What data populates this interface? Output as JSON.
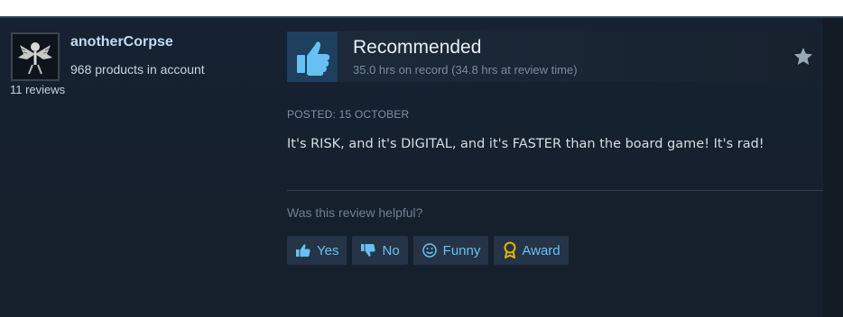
{
  "reviewer": {
    "username": "anotherCorpse",
    "products_text": "968 products in account",
    "reviews_text": "11 reviews",
    "avatar_icon": "skeletal-bird-avatar"
  },
  "review": {
    "verdict": "Recommended",
    "hours_text": "35.0 hrs on record (34.8 hrs at review time)",
    "posted_text": "POSTED: 15 OCTOBER",
    "body": "It's RISK, and it's DIGITAL, and it's FASTER than the board game! It's rad!",
    "thumb_icon": "thumbs-up-icon",
    "star_icon": "star-icon"
  },
  "helpful": {
    "question": "Was this review helpful?",
    "buttons": [
      {
        "label": "Yes",
        "icon": "thumbs-up-icon"
      },
      {
        "label": "No",
        "icon": "thumbs-down-icon"
      },
      {
        "label": "Funny",
        "icon": "smiley-icon"
      },
      {
        "label": "Award",
        "icon": "award-icon"
      }
    ]
  },
  "colors": {
    "card_bg": "#16202d",
    "accent_link": "#67c1f5",
    "username": "#c1dbf4",
    "award_gold": "#e2b600"
  }
}
